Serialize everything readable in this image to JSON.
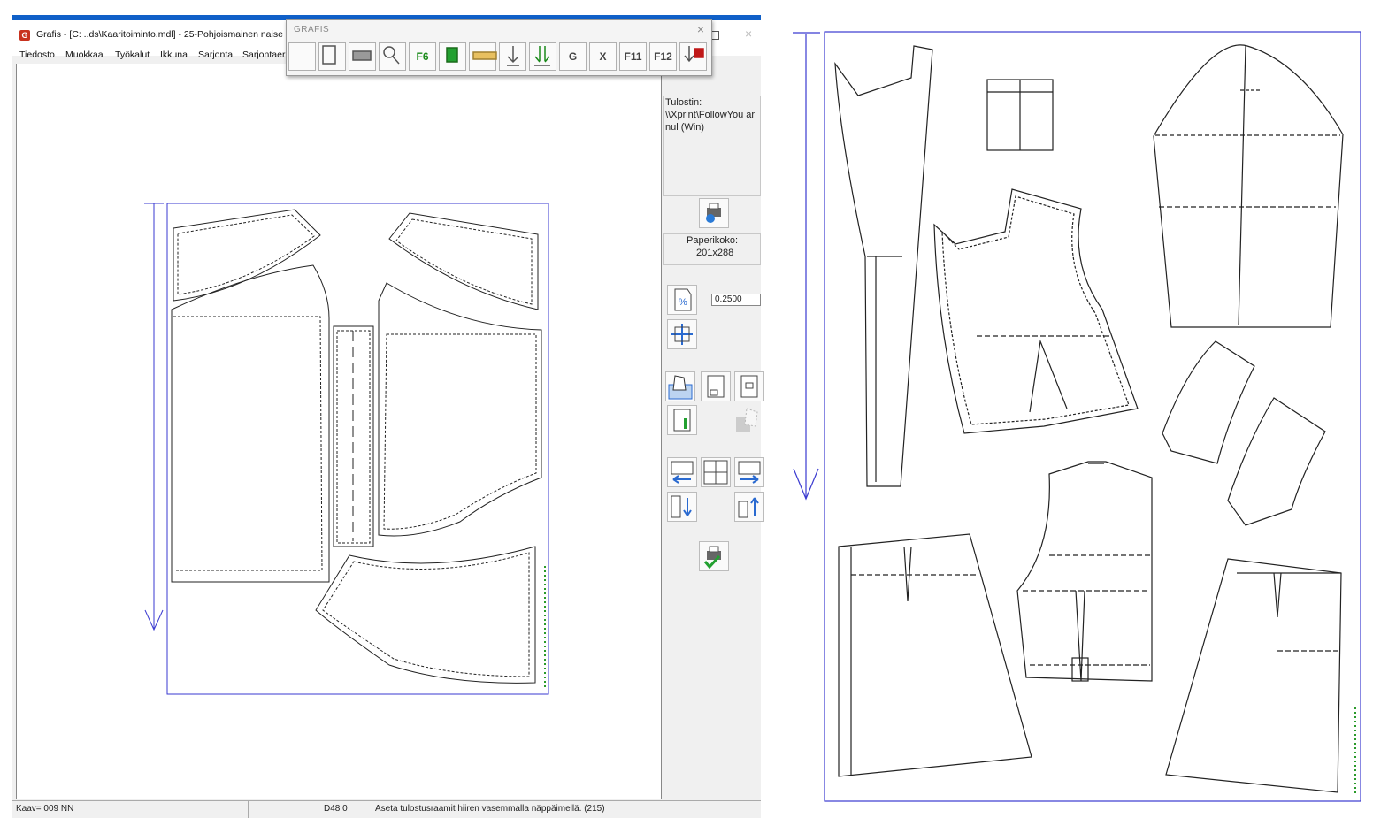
{
  "window": {
    "title": "Grafis - [C: ..ds\\Kaaritoiminto.mdl] - 25-Pohjoismainen naise",
    "accent_color": "#1060c8"
  },
  "menu": [
    "Tiedosto",
    "Muokkaa",
    "Työkalut",
    "Ikkuna",
    "Sarjonta",
    "Sarjontaero"
  ],
  "toolbar": {
    "title": "GRAFIS",
    "close": "×",
    "tools": [
      {
        "name": "import-icon",
        "label": ""
      },
      {
        "name": "save-icon",
        "label": ""
      },
      {
        "name": "printer-icon",
        "label": ""
      },
      {
        "name": "search-icon",
        "label": ""
      },
      {
        "name": "f6-network-icon",
        "label": "F6"
      },
      {
        "name": "copy-icon",
        "label": ""
      },
      {
        "name": "ruler-icon",
        "label": ""
      },
      {
        "name": "download-icon",
        "label": ""
      },
      {
        "name": "double-download-icon",
        "label": ""
      },
      {
        "name": "grafis-g-icon",
        "label": "G"
      },
      {
        "name": "x-icon",
        "label": "X"
      },
      {
        "name": "f11-zoom-icon",
        "label": "F11"
      },
      {
        "name": "f12-icon",
        "label": "F12"
      },
      {
        "name": "delete-download-icon",
        "label": ""
      }
    ]
  },
  "panel": {
    "printer_label": "Tulostin:",
    "printer_name": "\\\\Xprint\\FollowYou ar",
    "printer_port": "nul (Win)",
    "paper_label": "Paperikoko:",
    "paper_size": "201x288",
    "scale_value": "0.2500"
  },
  "status": {
    "left": "Kaav= 009  NN",
    "mid": "D48  0",
    "message": "Aseta tulostusraamit hiiren vasemmalla näppäimellä. (215)"
  }
}
